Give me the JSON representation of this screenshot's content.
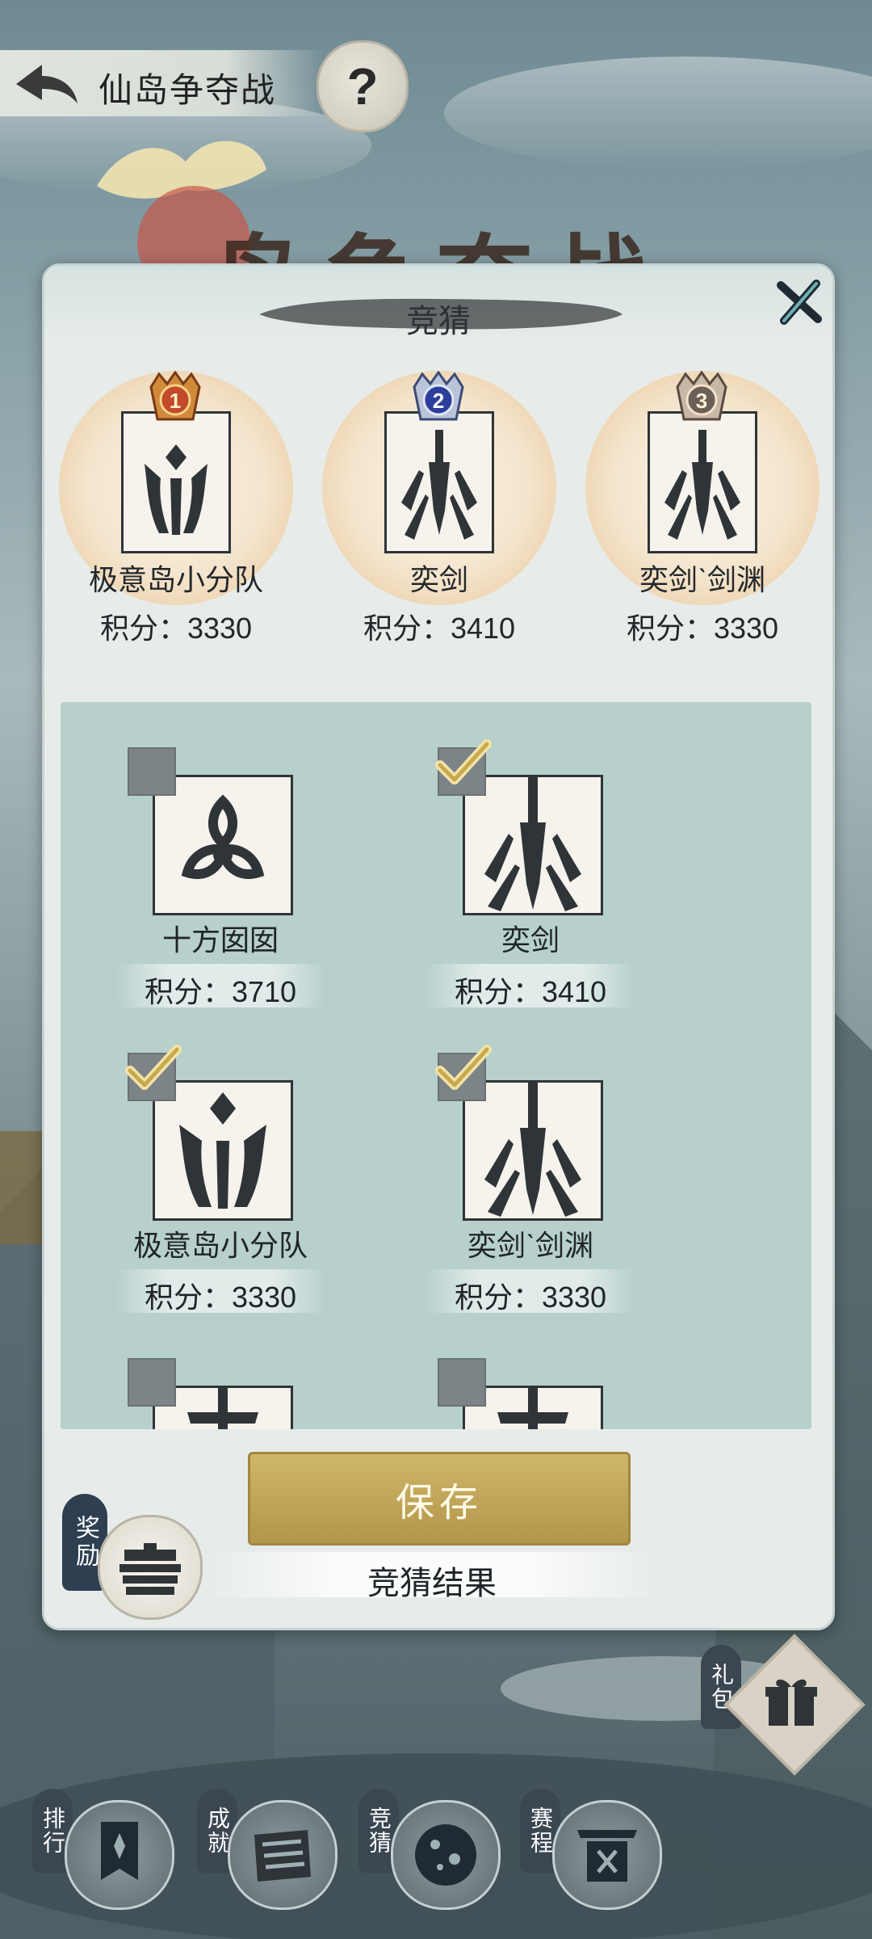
{
  "header": {
    "title": "仙岛争夺战",
    "help_label": "?",
    "banner_text": "岛争夺战"
  },
  "modal": {
    "title": "竞猜",
    "top3": [
      {
        "rank": "1",
        "name": "极意岛小分队",
        "score": "积分：3330",
        "emblem": "tulip-crest-icon",
        "medal_color": "#c24a2a"
      },
      {
        "rank": "2",
        "name": "奕剑",
        "score": "积分：3410",
        "emblem": "sword-crest-icon",
        "medal_color": "#2d3f9c"
      },
      {
        "rank": "3",
        "name": "奕剑ˋ剑渊",
        "score": "积分：3330",
        "emblem": "sword-crest-icon",
        "medal_color": "#6b5f58"
      }
    ],
    "teams": [
      {
        "name": "十方囡囡",
        "score": "积分：3710",
        "checked": false,
        "emblem": "trefoil-crest-icon"
      },
      {
        "name": "奕剑",
        "score": "积分：3410",
        "checked": true,
        "emblem": "sword-crest-icon"
      },
      {
        "name": "极意岛小分队",
        "score": "积分：3330",
        "checked": true,
        "emblem": "tulip-crest-icon"
      },
      {
        "name": "奕剑ˋ剑渊",
        "score": "积分：3330",
        "checked": true,
        "emblem": "sword-crest-icon"
      },
      {
        "name": "",
        "score": "",
        "checked": false,
        "emblem": "sword-crest-icon"
      },
      {
        "name": "",
        "score": "",
        "checked": false,
        "emblem": "sword-crest-icon"
      }
    ],
    "save_label": "保存",
    "result_label": "竞猜结果",
    "reward_tag": "奖励"
  },
  "nav": {
    "gift_tag": "礼包",
    "items": [
      {
        "label": "排行",
        "icon": "banner-icon"
      },
      {
        "label": "成就",
        "icon": "scroll-icon"
      },
      {
        "label": "竞猜",
        "icon": "ball-icon"
      },
      {
        "label": "赛程",
        "icon": "gate-icon"
      }
    ]
  },
  "colors": {
    "accent_gold": "#c2a45a",
    "panel_teal": "#b7d0cc",
    "ink": "#2f3438"
  }
}
